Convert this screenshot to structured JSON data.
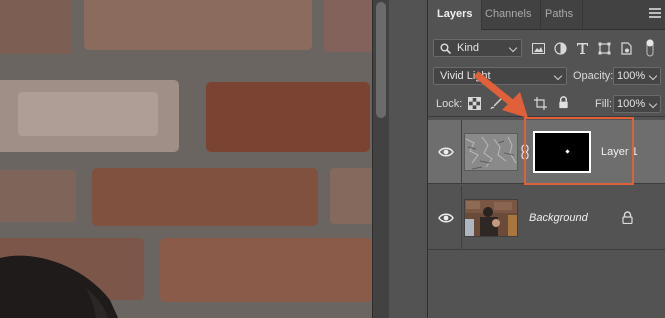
{
  "tabs": [
    {
      "label": "Layers",
      "active": true
    },
    {
      "label": "Channels",
      "active": false
    },
    {
      "label": "Paths",
      "active": false
    }
  ],
  "filter": {
    "label": "Kind"
  },
  "blend_mode": {
    "value": "Vivid Light"
  },
  "opacity": {
    "label": "Opacity:",
    "value": "100%"
  },
  "lock": {
    "label": "Lock:"
  },
  "fill": {
    "label": "Fill:",
    "value": "100%"
  },
  "layers": [
    {
      "name": "Layer 1",
      "visible": true,
      "selected": true,
      "has_mask": true
    },
    {
      "name": "Background",
      "visible": true,
      "selected": false,
      "locked": true
    }
  ],
  "annotation": {
    "color": "#e0603a"
  },
  "colors": {
    "panel": "#535353",
    "tabbar": "#424242",
    "selected_row": "#6e6e6e"
  }
}
